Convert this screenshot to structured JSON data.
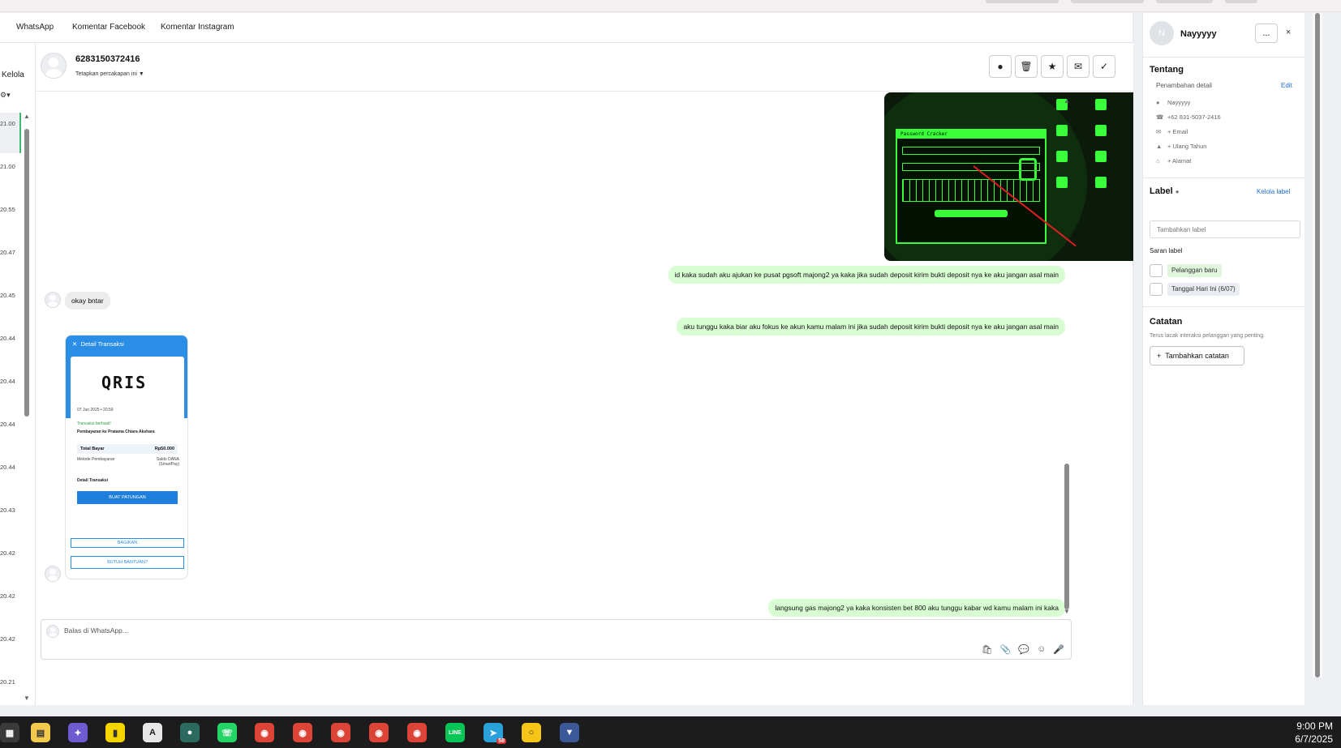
{
  "channel_tabs": [
    "WhatsApp",
    "Komentar Facebook",
    "Komentar Instagram"
  ],
  "left_column": {
    "kelola": "Kelola",
    "times": [
      "21.00",
      "21.00",
      "20.55",
      "20.47",
      "20.45",
      "20.44",
      "20.44",
      "20.44",
      "20.44",
      "20.43",
      "20.42",
      "20.42",
      "20.42",
      "20.21"
    ]
  },
  "chat_header": {
    "contact_number": "6283150372416",
    "set_conversation": "Tetapkan percakapan ini",
    "actions": [
      "info",
      "delete",
      "star",
      "email",
      "resolve"
    ]
  },
  "messages": [
    {
      "dir": "out",
      "type": "image",
      "desc": "Password Cracker screenshot"
    },
    {
      "dir": "out",
      "type": "text",
      "text": "id kaka sudah aku ajukan ke pusat pgsoft majong2 ya kaka jika sudah deposit kirim bukti deposit nya ke aku jangan asal main"
    },
    {
      "dir": "in",
      "type": "text",
      "text": "okay bntar"
    },
    {
      "dir": "out",
      "type": "text",
      "text": "aku tunggu kaka biar aku fokus ke akun kamu malam ini jika sudah deposit kirim bukti deposit nya ke aku jangan asal main"
    },
    {
      "dir": "in",
      "type": "image",
      "desc": "QRIS transaction receipt"
    },
    {
      "dir": "out",
      "type": "text",
      "text": "langsung gas majong2 ya kaka konsisten bet 800 aku  tunggu kabar wd kamu malam ini kaka"
    }
  ],
  "hacker_image": {
    "window_title": "Password Cracker",
    "start_button": "Start brute force attack"
  },
  "qris_receipt": {
    "header": "Detail Transaksi",
    "logo": "QRIS",
    "date": "07 Jun 2025 • 20.59",
    "status": "Transaksi berhasil!",
    "payee": "Pembayaran ke Pratama Chiara Akshara",
    "total_label": "Total Bayar",
    "total_value": "Rp50.000",
    "method_label": "Metode Pembayaran",
    "method_value": "Saldo DANA (SmartPay)",
    "detail_label": "Detail Transaksi",
    "button_primary": "BUAT PATUNGAN",
    "button_share": "BAGIKAN",
    "button_help": "BUTUH BANTUAN?"
  },
  "reply": {
    "placeholder": "Balas di WhatsApp..."
  },
  "right_panel": {
    "avatar_initial": "N",
    "name": "Nayyyyy",
    "more": "...",
    "close": "×",
    "about_title": "Tentang",
    "add_detail": "Penambahan detail",
    "edit": "Edit",
    "details": [
      {
        "icon": "person-icon",
        "glyph": "●",
        "text": "Nayyyyy"
      },
      {
        "icon": "phone-icon",
        "glyph": "☎",
        "text": "+62 831-5037-2416"
      },
      {
        "icon": "mail-icon",
        "glyph": "✉",
        "text": "+ Email"
      },
      {
        "icon": "cake-icon",
        "glyph": "⌂",
        "text": "+ Ulang Tahun"
      },
      {
        "icon": "home-icon",
        "glyph": "⌂",
        "text": "+ Alamat"
      }
    ],
    "label_title": "Label",
    "manage_labels": "Kelola label",
    "add_label_placeholder": "Tambahkan label",
    "suggestions_title": "Saran label",
    "suggestions": [
      "Pelanggan baru",
      "Tanggal Hari Ini (6/07)"
    ],
    "notes_title": "Catatan",
    "notes_desc": "Terus lacak interaksi pelanggan yang penting.",
    "add_note": "Tambahkan catatan"
  },
  "taskbar": {
    "time": "9:00 PM",
    "date": "6/7/2025",
    "telegram_badge": "58"
  }
}
